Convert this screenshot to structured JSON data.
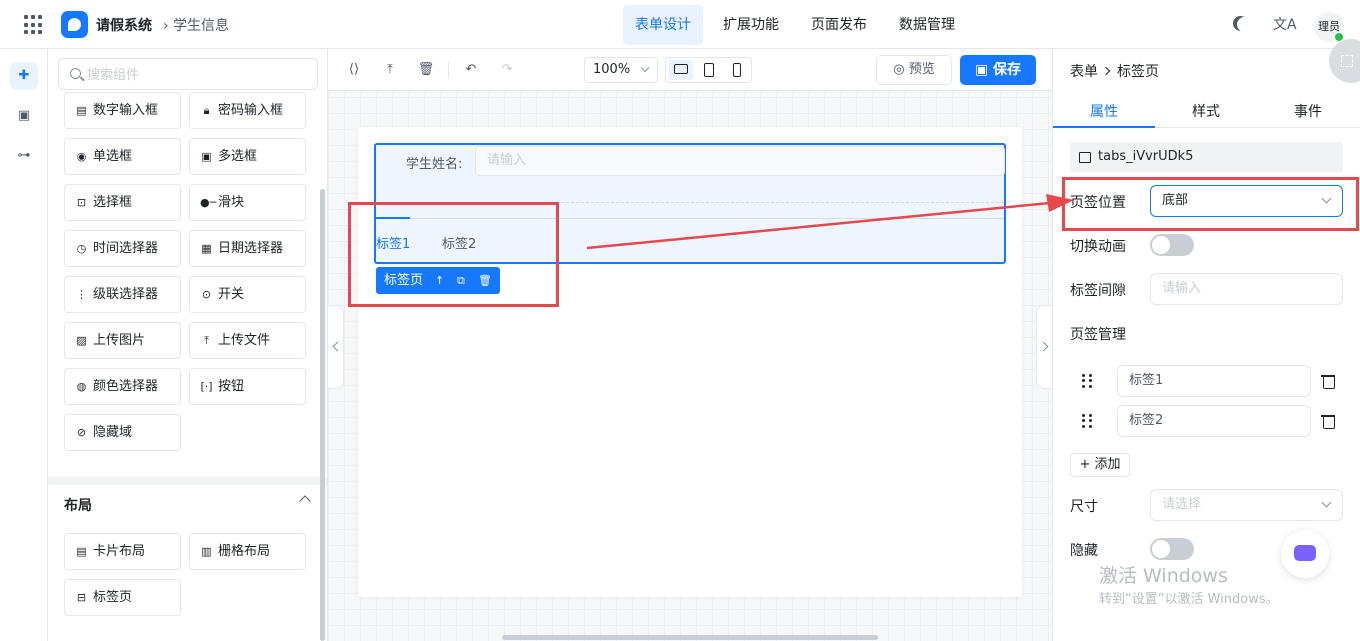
{
  "header": {
    "app_title": "请假系统",
    "breadcrumb": "学生信息",
    "nav": [
      "表单设计",
      "扩展功能",
      "页面发布",
      "数据管理"
    ],
    "active_nav": "表单设计",
    "avatar_text": "理员"
  },
  "rail": {
    "icons": [
      "puzzle-icon",
      "form-icon",
      "tree-icon"
    ]
  },
  "panel": {
    "search_placeholder": "搜索组件",
    "components": [
      {
        "label": "数字输入框",
        "icon": "number-input-icon",
        "glyph": "▤"
      },
      {
        "label": "密码输入框",
        "icon": "lock-icon",
        "glyph": "🔒︎"
      },
      {
        "label": "单选框",
        "icon": "radio-icon",
        "glyph": "◉"
      },
      {
        "label": "多选框",
        "icon": "checkbox-icon",
        "glyph": "▣"
      },
      {
        "label": "选择框",
        "icon": "select-icon",
        "glyph": "⊡"
      },
      {
        "label": "滑块",
        "icon": "slider-icon",
        "glyph": "●─"
      },
      {
        "label": "时间选择器",
        "icon": "clock-icon",
        "glyph": "◷"
      },
      {
        "label": "日期选择器",
        "icon": "calendar-icon",
        "glyph": "▦"
      },
      {
        "label": "级联选择器",
        "icon": "cascader-icon",
        "glyph": "⋮"
      },
      {
        "label": "开关",
        "icon": "switch-icon",
        "glyph": "⊙"
      },
      {
        "label": "上传图片",
        "icon": "image-icon",
        "glyph": "▨"
      },
      {
        "label": "上传文件",
        "icon": "upload-icon",
        "glyph": "⤒"
      },
      {
        "label": "颜色选择器",
        "icon": "palette-icon",
        "glyph": "◍"
      },
      {
        "label": "按钮",
        "icon": "button-icon",
        "glyph": "[·]"
      },
      {
        "label": "隐藏域",
        "icon": "eye-off-icon",
        "glyph": "⊘"
      }
    ],
    "layout_section": "布局",
    "layout_components": [
      {
        "label": "卡片布局",
        "icon": "card-icon",
        "glyph": "▤"
      },
      {
        "label": "栅格布局",
        "icon": "grid-layout-icon",
        "glyph": "▥"
      },
      {
        "label": "标签页",
        "icon": "tabs-icon",
        "glyph": "⊟"
      }
    ]
  },
  "toolbar": {
    "zoom": "100%",
    "preview_label": "预览",
    "save_label": "保存"
  },
  "form": {
    "field_label": "学生姓名:",
    "field_placeholder": "请输入",
    "tabs": [
      "标签1",
      "标签2"
    ],
    "selected_label": "标签页"
  },
  "props": {
    "breadcrumb_parent": "表单",
    "breadcrumb_child": "标签页",
    "tabs": [
      "属性",
      "样式",
      "事件"
    ],
    "component_id": "tabs_iVvrUDk5",
    "tab_position_label": "页签位置",
    "tab_position_value": "底部",
    "animation_label": "切换动画",
    "gap_label": "标签间隙",
    "gap_placeholder": "请输入",
    "manage_label": "页签管理",
    "tab_items": [
      "标签1",
      "标签2"
    ],
    "add_label": "+ 添加",
    "size_label": "尺寸",
    "size_placeholder": "请选择",
    "hidden_label": "隐藏"
  },
  "watermark": {
    "line1": "激活 Windows",
    "line2": "转到“设置”以激活 Windows。"
  },
  "colors": {
    "accent": "#1677ff",
    "annotation": "#e5484d"
  }
}
